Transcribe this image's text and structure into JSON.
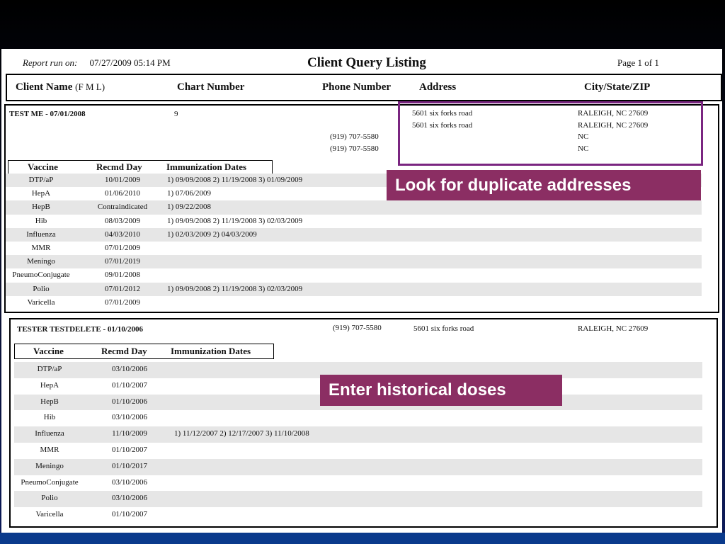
{
  "report": {
    "run_on_label": "Report run on:",
    "run_on_value": "07/27/2009 05:14 PM",
    "title": "Client Query Listing",
    "page": "Page 1 of 1"
  },
  "columns": {
    "client_name": "Client Name",
    "client_name_suffix": "(F M L)",
    "chart_number": "Chart Number",
    "phone_number": "Phone Number",
    "address": "Address",
    "city_state_zip": "City/State/ZIP"
  },
  "vaccine_headers": {
    "vaccine": "Vaccine",
    "recmd_day": "Recmd Day",
    "immunization_dates": "Immunization Dates"
  },
  "clients": [
    {
      "name": "TEST ME - 07/01/2008",
      "chart": "9",
      "addresses": [
        {
          "line": "5601 six forks road",
          "city": "RALEIGH, NC  27609"
        },
        {
          "line": "5601 six forks road",
          "city": "RALEIGH, NC  27609"
        },
        {
          "line": "",
          "city": "NC"
        },
        {
          "line": "",
          "city": "NC"
        }
      ],
      "phones": [
        "(919) 707-5580",
        "(919) 707-5580"
      ],
      "vaccines": [
        {
          "name": "DTP/aP",
          "day": "10/01/2009",
          "dates": "1) 09/09/2008   2) 11/19/2008   3) 01/09/2009"
        },
        {
          "name": "HepA",
          "day": "01/06/2010",
          "dates": "1) 07/06/2009"
        },
        {
          "name": "HepB",
          "day": "Contraindicated",
          "dates": "1) 09/22/2008"
        },
        {
          "name": "Hib",
          "day": "08/03/2009",
          "dates": "1) 09/09/2008   2) 11/19/2008   3) 02/03/2009"
        },
        {
          "name": "Influenza",
          "day": "04/03/2010",
          "dates": "1) 02/03/2009   2) 04/03/2009"
        },
        {
          "name": "MMR",
          "day": "07/01/2009",
          "dates": ""
        },
        {
          "name": "Meningo",
          "day": "07/01/2019",
          "dates": ""
        },
        {
          "name": "PneumoConjugate",
          "day": "09/01/2008",
          "dates": ""
        },
        {
          "name": "Polio",
          "day": "07/01/2012",
          "dates": "1) 09/09/2008   2) 11/19/2008   3) 02/03/2009"
        },
        {
          "name": "Varicella",
          "day": "07/01/2009",
          "dates": ""
        }
      ]
    },
    {
      "name": "TESTER TESTDELETE - 01/10/2006",
      "phone": "(919) 707-5580",
      "address": "5601 six forks road",
      "city": "RALEIGH, NC  27609",
      "vaccines": [
        {
          "name": "DTP/aP",
          "day": "03/10/2006",
          "dates": ""
        },
        {
          "name": "HepA",
          "day": "01/10/2007",
          "dates": ""
        },
        {
          "name": "HepB",
          "day": "01/10/2006",
          "dates": ""
        },
        {
          "name": "Hib",
          "day": "03/10/2006",
          "dates": ""
        },
        {
          "name": "Influenza",
          "day": "11/10/2009",
          "dates": "1) 11/12/2007   2) 12/17/2007   3) 11/10/2008"
        },
        {
          "name": "MMR",
          "day": "01/10/2007",
          "dates": ""
        },
        {
          "name": "Meningo",
          "day": "01/10/2017",
          "dates": ""
        },
        {
          "name": "PneumoConjugate",
          "day": "03/10/2006",
          "dates": ""
        },
        {
          "name": "Polio",
          "day": "03/10/2006",
          "dates": ""
        },
        {
          "name": "Varicella",
          "day": "01/10/2007",
          "dates": ""
        }
      ]
    }
  ],
  "callouts": {
    "duplicates": "Look for duplicate addresses",
    "historical": "Enter historical doses"
  },
  "colors": {
    "callout_bg": "#8b2e63",
    "highlight_border": "#7a2580",
    "row_band": "#e6e6e6"
  }
}
